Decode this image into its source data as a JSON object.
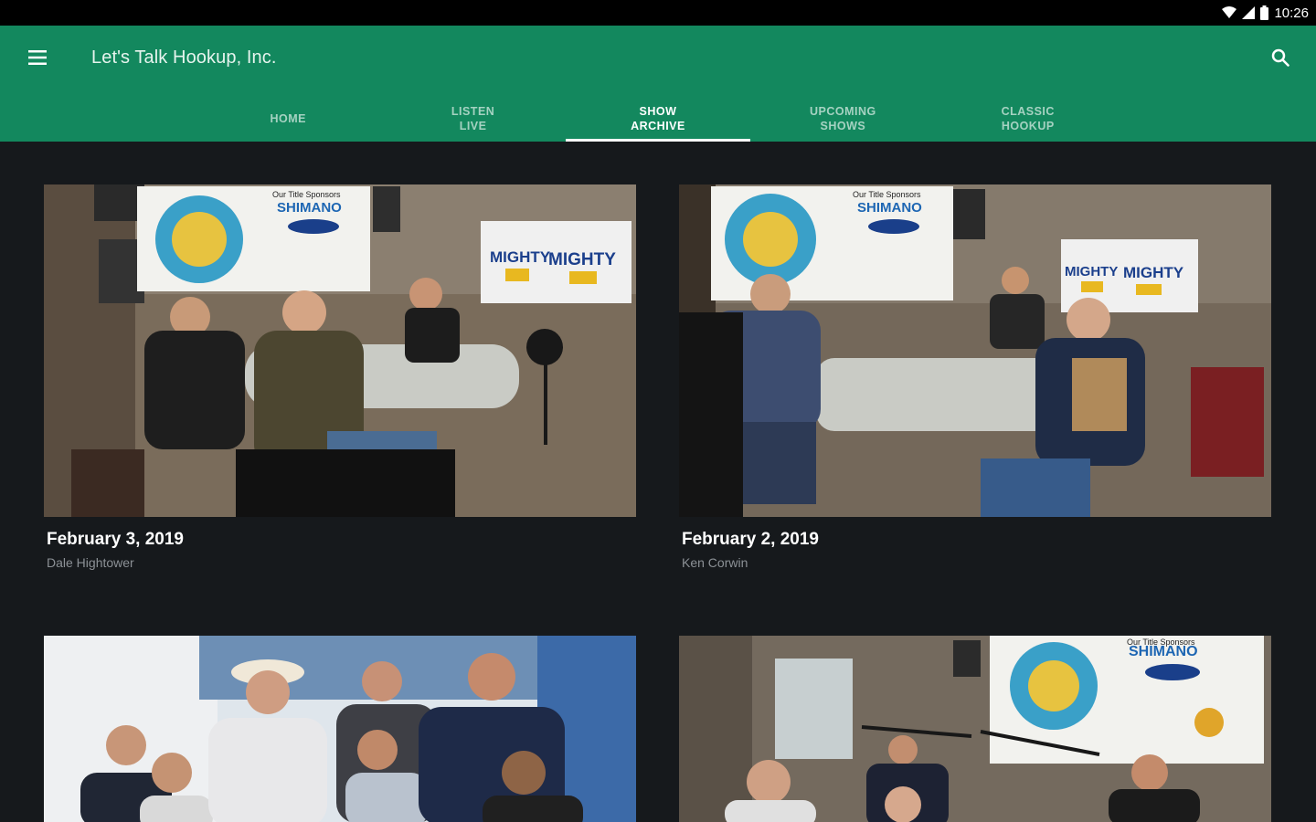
{
  "status_bar": {
    "time": "10:26",
    "icons": [
      "wifi-icon",
      "cell-signal-icon",
      "battery-icon"
    ]
  },
  "app_bar": {
    "title": "Let's Talk Hookup, Inc.",
    "menu_icon": "hamburger-menu-icon",
    "search_icon": "search-icon",
    "color": "#13885e"
  },
  "tabs": [
    {
      "label": "HOME",
      "active": false
    },
    {
      "label": "LISTEN\nLIVE",
      "active": false
    },
    {
      "label": "SHOW\nARCHIVE",
      "active": true
    },
    {
      "label": "UPCOMING\nSHOWS",
      "active": false
    },
    {
      "label": "CLASSIC\nHOOKUP",
      "active": false
    }
  ],
  "episodes": [
    {
      "date": "February 3, 2019",
      "host": "Dale Hightower"
    },
    {
      "date": "February 2, 2019",
      "host": "Ken Corwin"
    },
    {
      "date": "",
      "host": ""
    },
    {
      "date": "",
      "host": ""
    }
  ],
  "thumbnail_banner_text": {
    "sponsor_line": "Our Title Sponsors",
    "sponsor_brand": "SHIMANO",
    "station": "MIGHTY"
  }
}
